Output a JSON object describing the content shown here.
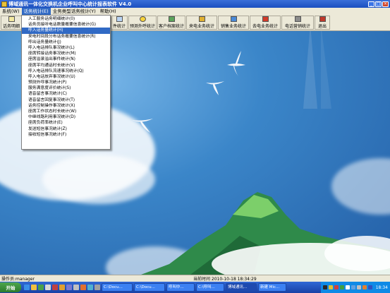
{
  "window": {
    "title": "博域通讯一体化交换机企业呼叫中心统计报表软件  V4.0"
  },
  "menu": {
    "items": [
      {
        "label": "系统(W)"
      },
      {
        "label": "话务统计(E)"
      },
      {
        "label": "业务类型话务统计(Y)"
      },
      {
        "label": "帮助(H)"
      }
    ]
  },
  "toolbar": {
    "buttons": [
      {
        "label": "话务明细",
        "icon": "report-icon"
      },
      {
        "label": "件统计",
        "icon": "stats-icon"
      },
      {
        "label": "预测外呼统计",
        "icon": "sun-icon"
      },
      {
        "label": "客户档案统计",
        "icon": "chart-icon"
      },
      {
        "label": "来电业务统计",
        "icon": "phone-icon"
      },
      {
        "label": "销售业务统计",
        "icon": "cart-icon"
      },
      {
        "label": "去电业务统计",
        "icon": "outgoing-icon"
      },
      {
        "label": "电话营销统计",
        "icon": "marketing-icon"
      },
      {
        "label": "退出",
        "icon": "exit-icon"
      }
    ]
  },
  "dropdown": {
    "items": [
      "人工服务话务明细统计(0)",
      "话务员接听电话数量概要信息统计(G)",
      "呼入话务量统计(H)",
      "来电时间段分布话务概要信息统计(R)",
      "呼出话务量统计(J)",
      "呼入电话排队事况统计(L)",
      "座席转接话务事况统计(M)",
      "座席溢录溢出事件统计(N)",
      "座席平均通话时长统计(V)",
      "呼入电话排队流速事况统计(Q)",
      "呼入电话放弃事况统计(U)",
      "预测外呼事况统计(P)",
      "服务满意度评价统计(S)",
      "语音留言事况统计(C)",
      "语音留言回复事况统计(T)",
      "话务控制操作事况统计(X)",
      "座席工作状态时长统计(W)",
      "中继线路利用事况统计(D)",
      "座席负荷率统计(E)",
      "发送短信事况统计(Z)",
      "接收短信事况统计(F)"
    ],
    "selected_index": 2
  },
  "status": {
    "operator_label": "操作员:manager",
    "time_label": "当前时间 2010-10-18 18:34:29"
  },
  "taskbar": {
    "start_label": "开始",
    "tasks": [
      {
        "label": "C:\\Docu...",
        "active": false
      },
      {
        "label": "C:\\Docu...",
        "active": false
      },
      {
        "label": "呼叫中...",
        "active": false
      },
      {
        "label": "C:\\呼叫...",
        "active": false
      },
      {
        "label": "博域通讯...",
        "active": true
      },
      {
        "label": "新建 Mic...",
        "active": false
      }
    ],
    "clock": "18:34"
  },
  "colors": {
    "titlebar": "#1b4fc0",
    "menu_selected": "#316ac5",
    "chrome": "#ece9d8",
    "taskbar": "#245edb",
    "start": "#3c9a3c"
  }
}
